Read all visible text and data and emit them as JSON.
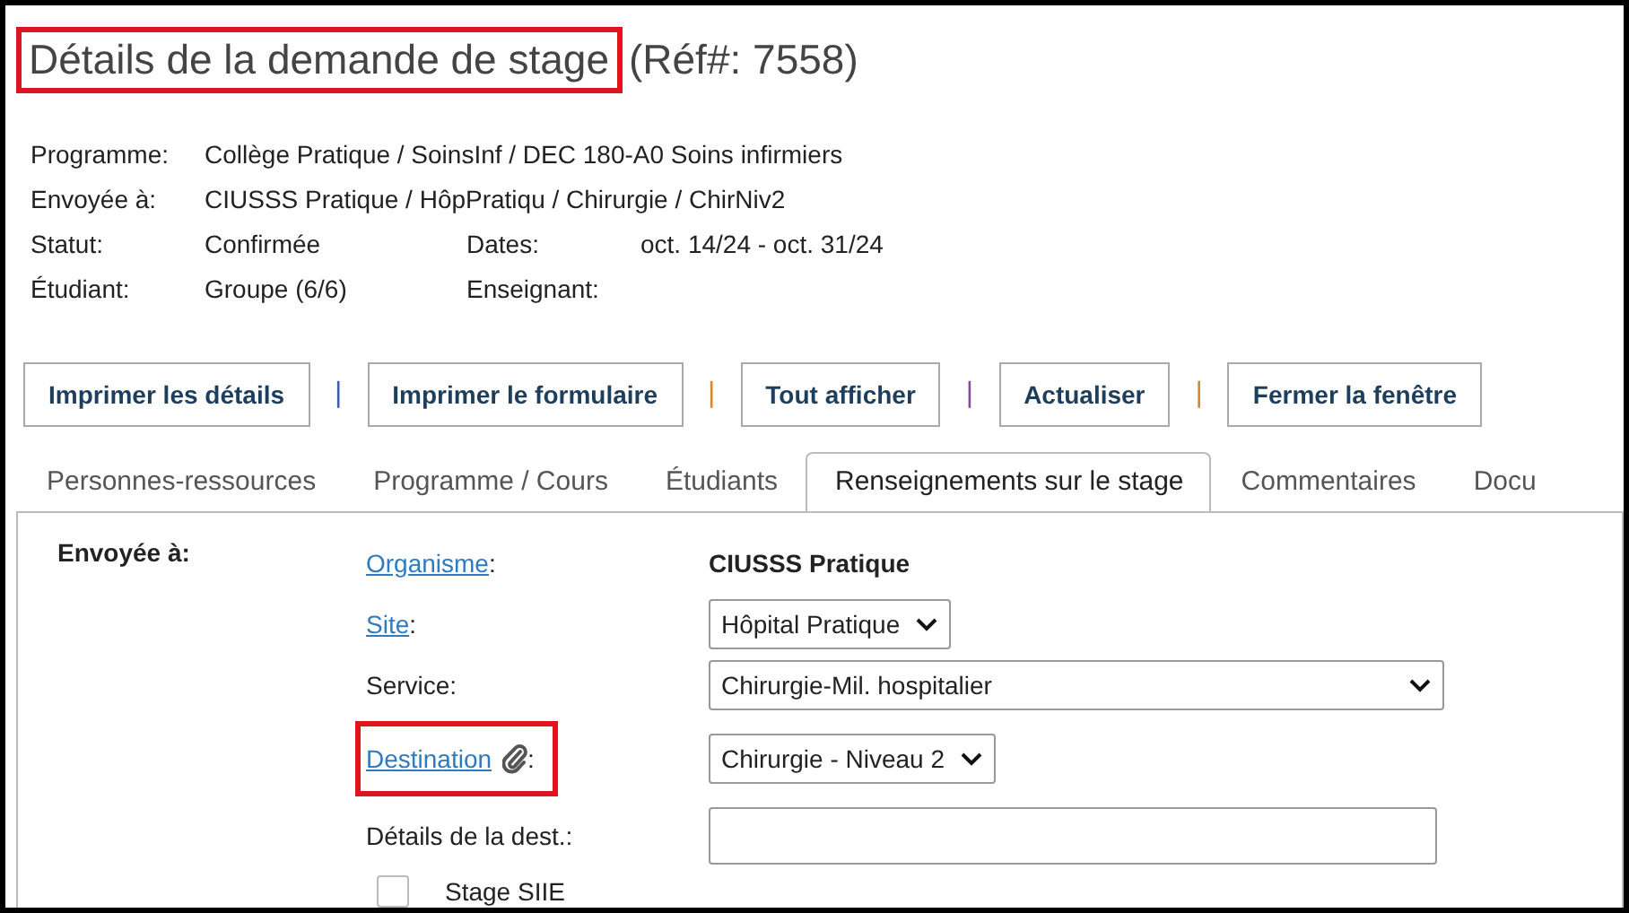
{
  "title": {
    "text": "Détails de la demande de stage",
    "highlighted": true,
    "ref": "(Réf#: 7558)"
  },
  "summary": [
    {
      "label": "Programme:",
      "value": "Collège Pratique / SoinsInf / DEC 180-A0 Soins infirmiers"
    },
    {
      "label": "Envoyée à:",
      "value": "CIUSSS Pratique / HôpPratiqu / Chirurgie / ChirNiv2"
    },
    {
      "label": "Statut:",
      "value": "Confirmée",
      "label2": "Dates:",
      "value2": "oct. 14/24 - oct. 31/24"
    },
    {
      "label": "Étudiant:",
      "value": "Groupe (6/6)",
      "label2": "Enseignant:"
    }
  ],
  "buttons": [
    {
      "label": "Imprimer les détails"
    },
    {
      "separator": "|",
      "color": "#3a5fa8",
      "label": "Imprimer le formulaire"
    },
    {
      "separator": "|",
      "color": "#d08a2a",
      "label": "Tout afficher"
    },
    {
      "separator": "|",
      "color": "#7a4fa0",
      "label": "Actualiser"
    },
    {
      "separator": "|",
      "color": "#d08a2a",
      "label": "Fermer la fenêtre"
    }
  ],
  "tabs": [
    {
      "label": "Personnes-ressources",
      "selected": false
    },
    {
      "label": "Programme / Cours",
      "selected": false
    },
    {
      "label": "Étudiants",
      "selected": false
    },
    {
      "label": "Renseignements sur le stage",
      "selected": true
    },
    {
      "label": "Commentaires",
      "selected": false
    },
    {
      "label": "Docu",
      "selected": false
    }
  ],
  "section": {
    "heading": "Envoyée à:",
    "rows": [
      {
        "label": "Organisme",
        "linked": true,
        "colon": ":",
        "kind": "static",
        "value": "CIUSSS Pratique"
      },
      {
        "label": "Site",
        "linked": true,
        "colon": ":",
        "kind": "select",
        "value": "Hôpital Pratique"
      },
      {
        "label": "Service:",
        "linked": false,
        "kind": "select",
        "value": "Chirurgie-Mil. hospitalier"
      },
      {
        "label": "Destination",
        "linked": true,
        "colon": ":",
        "attachment": true,
        "highlighted": true,
        "kind": "select",
        "value": "Chirurgie - Niveau 2"
      },
      {
        "label": "Détails de la dest.:",
        "linked": false,
        "kind": "input"
      },
      {
        "label": "Stage SIIE",
        "kind": "checkbox",
        "checked": false
      }
    ]
  }
}
